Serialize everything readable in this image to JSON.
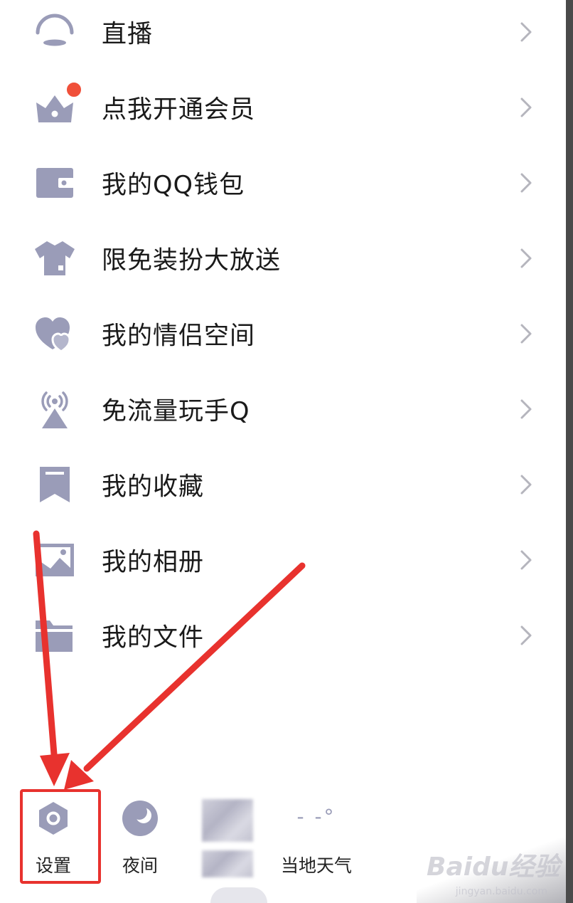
{
  "menu": {
    "items": [
      {
        "label": "直播",
        "icon": "live-broadcast-icon"
      },
      {
        "label": "点我开通会员",
        "icon": "vip-crown-icon",
        "badge": true
      },
      {
        "label": "我的QQ钱包",
        "icon": "wallet-icon"
      },
      {
        "label": "限免装扮大放送",
        "icon": "tshirt-icon"
      },
      {
        "label": "我的情侣空间",
        "icon": "hearts-icon"
      },
      {
        "label": "免流量玩手Q",
        "icon": "signal-tower-icon"
      },
      {
        "label": "我的收藏",
        "icon": "bookmark-icon"
      },
      {
        "label": "我的相册",
        "icon": "photo-album-icon"
      },
      {
        "label": "我的文件",
        "icon": "folder-icon"
      }
    ]
  },
  "bottom_bar": {
    "settings_label": "设置",
    "night_label": "夜间",
    "weather_label": "当地天气",
    "weather_value": "- -°"
  },
  "watermark": {
    "brand": "Baidu经验",
    "url": "jingyan.baidu.com"
  },
  "colors": {
    "icon": "#9a9cb8",
    "text": "#1a1a1a",
    "chevron": "#b5b5bd",
    "badge": "#f0503a",
    "annotation": "#e8322e"
  }
}
